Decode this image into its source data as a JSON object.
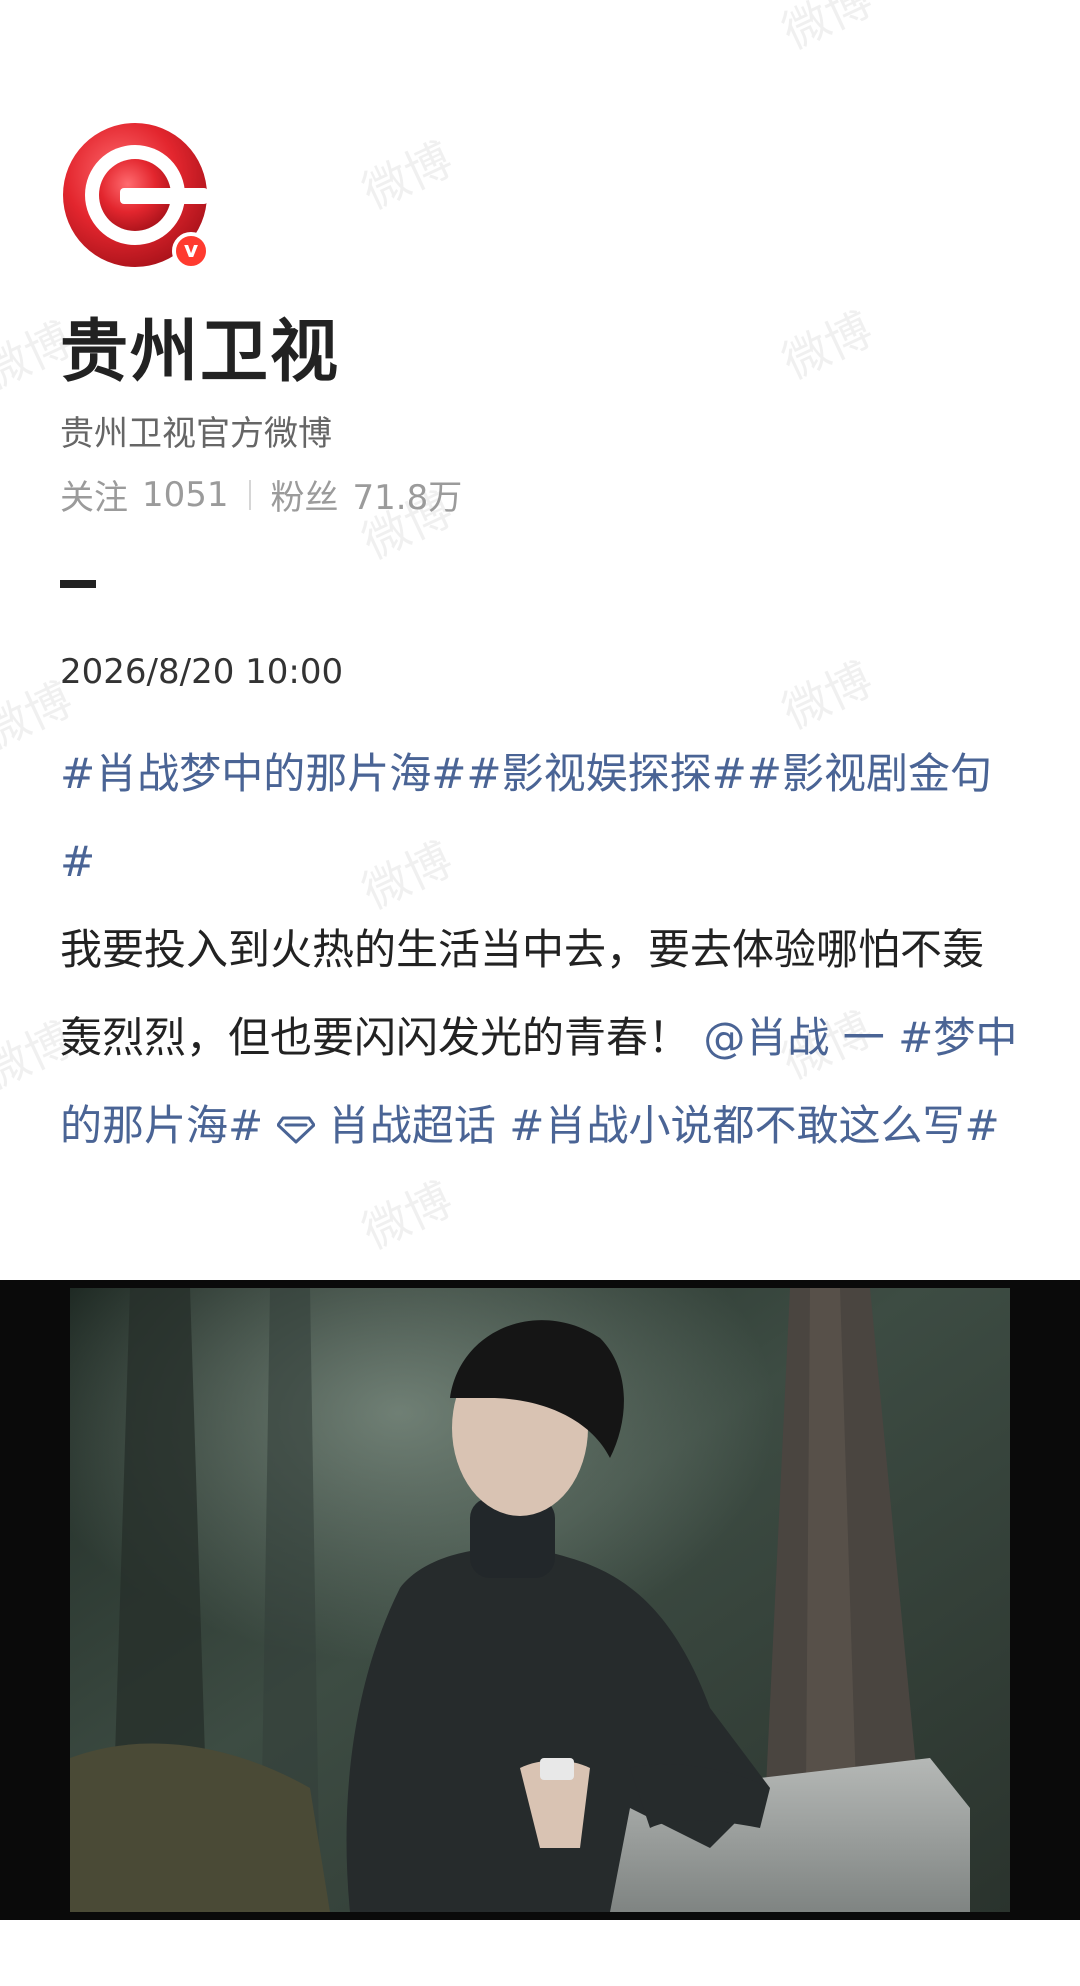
{
  "account": {
    "name": "贵州卫视",
    "description": "贵州卫视官方微博",
    "verified_mark": "v"
  },
  "stats": {
    "following_label": "关注",
    "following_count": "1051",
    "followers_label": "粉丝",
    "followers_count": "71.8万"
  },
  "post": {
    "timestamp": "2026/8/20 10:00",
    "tags_line": "#肖战梦中的那片海##影视娱探探##影视剧金句#",
    "body": "我要投入到火热的生活当中去，要去体验哪怕不轰轰烈烈，但也要闪闪发光的青春！",
    "mention": "@肖战",
    "dash": " 一",
    "tag_after_mention": "#梦中的那片海#",
    "super_topic": "肖战超话",
    "last_tag": " #肖战小说都不敢这么写#"
  },
  "watermark": "微博",
  "colors": {
    "link": "#4a6495",
    "brand_red": "#e3262e",
    "badge": "#ff3b2f"
  },
  "icons": {
    "avatar": "guizhou-tv-logo",
    "verified": "verified-v-icon",
    "super_topic": "diamond-icon"
  }
}
